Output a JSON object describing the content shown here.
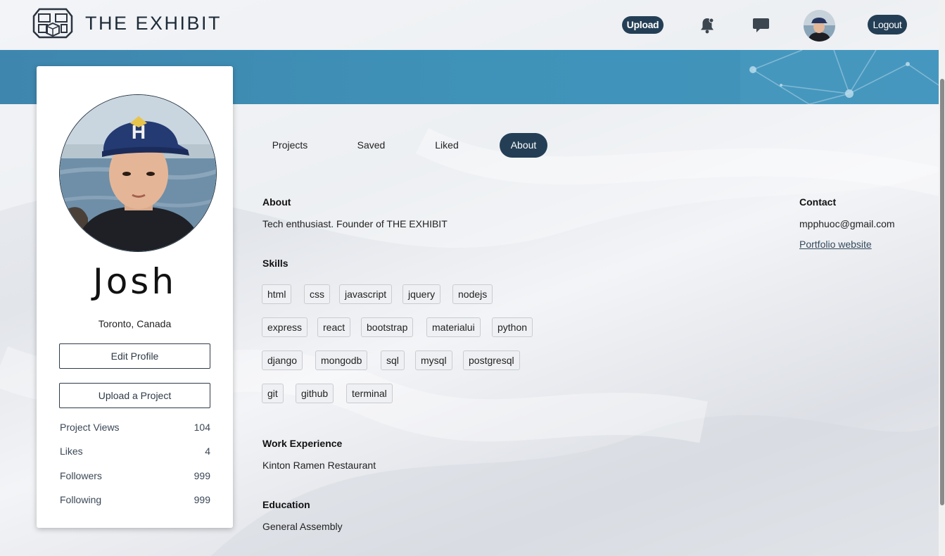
{
  "header": {
    "brand": "THE EXHIBIT",
    "upload_label": "Upload",
    "logout_label": "Logout"
  },
  "profile": {
    "name": "Josh",
    "location": "Toronto, Canada",
    "edit_label": "Edit Profile",
    "upload_project_label": "Upload a Project",
    "stats": [
      {
        "label": "Project Views",
        "value": "104"
      },
      {
        "label": "Likes",
        "value": "4"
      },
      {
        "label": "Followers",
        "value": "999"
      },
      {
        "label": "Following",
        "value": "999"
      }
    ]
  },
  "tabs": [
    {
      "label": "Projects"
    },
    {
      "label": "Saved"
    },
    {
      "label": "Liked"
    },
    {
      "label": "About",
      "active": true
    }
  ],
  "about": {
    "about_heading": "About",
    "about_text": "Tech enthusiast. Founder of THE EXHIBIT",
    "skills_heading": "Skills",
    "skills": [
      "html",
      "css",
      "javascript",
      "jquery",
      "nodejs",
      "express",
      "react",
      "bootstrap",
      "materialui",
      "python",
      "django",
      "mongodb",
      "sql",
      "mysql",
      "postgresql",
      "git",
      "github",
      "terminal"
    ],
    "work_heading": "Work Experience",
    "work_text": "Kinton Ramen Restaurant",
    "education_heading": "Education",
    "education_text": "General Assembly"
  },
  "contact": {
    "heading": "Contact",
    "email": "mpphuoc@gmail.com",
    "portfolio_label": "Portfolio website"
  },
  "colors": {
    "accent": "#243f55",
    "banner": "#3f8fb6"
  }
}
